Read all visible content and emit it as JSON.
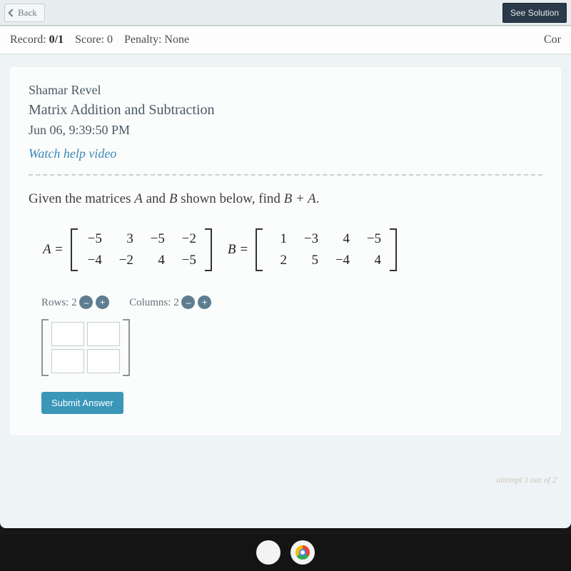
{
  "topbar": {
    "back": "Back",
    "see_solution": "See Solution"
  },
  "recordbar": {
    "record_label": "Record:",
    "record_value": "0/1",
    "score_label": "Score:",
    "score_value": "0",
    "penalty_label": "Penalty:",
    "penalty_value": "None",
    "right_partial": "Cor"
  },
  "header": {
    "student": "Shamar Revel",
    "topic": "Matrix Addition and Subtraction",
    "date": "Jun 06, 9:39:50 PM",
    "watch": "Watch help video"
  },
  "question": {
    "prefix": "Given the matrices ",
    "a": "A",
    "mid1": " and ",
    "b": "B",
    "mid2": " shown below, find ",
    "expr": "B + A",
    "suffix": "."
  },
  "matrix_a_label": "A =",
  "matrix_b_label": "B =",
  "matrix_a": [
    "−5",
    "3",
    "−5",
    "−2",
    "−4",
    "−2",
    "4",
    "−5"
  ],
  "matrix_b": [
    "1",
    "−3",
    "4",
    "−5",
    "2",
    "5",
    "−4",
    "4"
  ],
  "controls": {
    "rows_label": "Rows:",
    "rows_value": "2",
    "cols_label": "Columns:",
    "cols_value": "2",
    "minus": "–",
    "plus": "+"
  },
  "submit_label": "Submit Answer",
  "attempt_text": "attempt 1 out of 2"
}
